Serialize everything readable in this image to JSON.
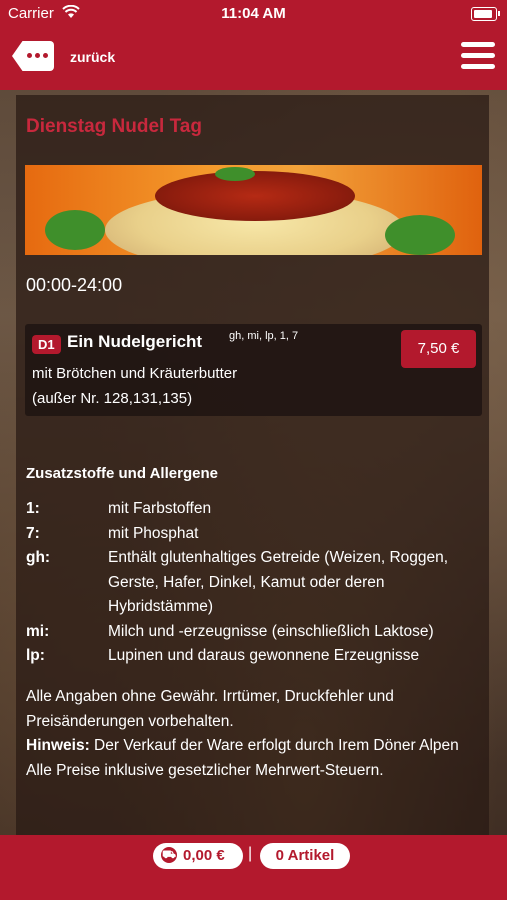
{
  "status": {
    "carrier": "Carrier",
    "time": "11:04 AM"
  },
  "nav": {
    "back_label": "zurück"
  },
  "page": {
    "title": "Dienstag Nudel Tag",
    "hours": "00:00-24:00"
  },
  "item": {
    "code": "D1",
    "name": "Ein Nudelgericht",
    "allergens": "gh, mi, lp, 1, 7",
    "desc1": "mit Brötchen und Kräuterbutter",
    "desc2": "(außer Nr. 128,131,135)",
    "price": "7,50 €"
  },
  "allergens": {
    "title": "Zusatzstoffe und Allergene",
    "items": [
      {
        "key": "1:",
        "text": "mit Farbstoffen"
      },
      {
        "key": "7:",
        "text": "mit Phosphat"
      },
      {
        "key": "gh:",
        "text": "Enthält glutenhaltiges Getreide (Weizen, Roggen, Gerste, Hafer, Dinkel, Kamut oder deren Hybridstämme)"
      },
      {
        "key": "mi:",
        "text": "Milch und -erzeugnisse (einschließlich Laktose)"
      },
      {
        "key": "lp:",
        "text": "Lupinen und daraus gewonnene Erzeugnisse"
      }
    ]
  },
  "notes": {
    "disclaimer": "Alle Angaben ohne Gewähr. Irrtümer, Druckfehler und Preisänderungen vorbehalten.",
    "hint_label": "Hinweis:",
    "hint_text": " Der Verkauf der Ware erfolgt durch Irem Döner Alpen",
    "tax": "Alle Preise inklusive gesetzlicher Mehrwert-Steuern."
  },
  "cart": {
    "total": "0,00 €",
    "separator": "|",
    "articles": "0 Artikel"
  },
  "colors": {
    "brand": "#b3192d"
  }
}
